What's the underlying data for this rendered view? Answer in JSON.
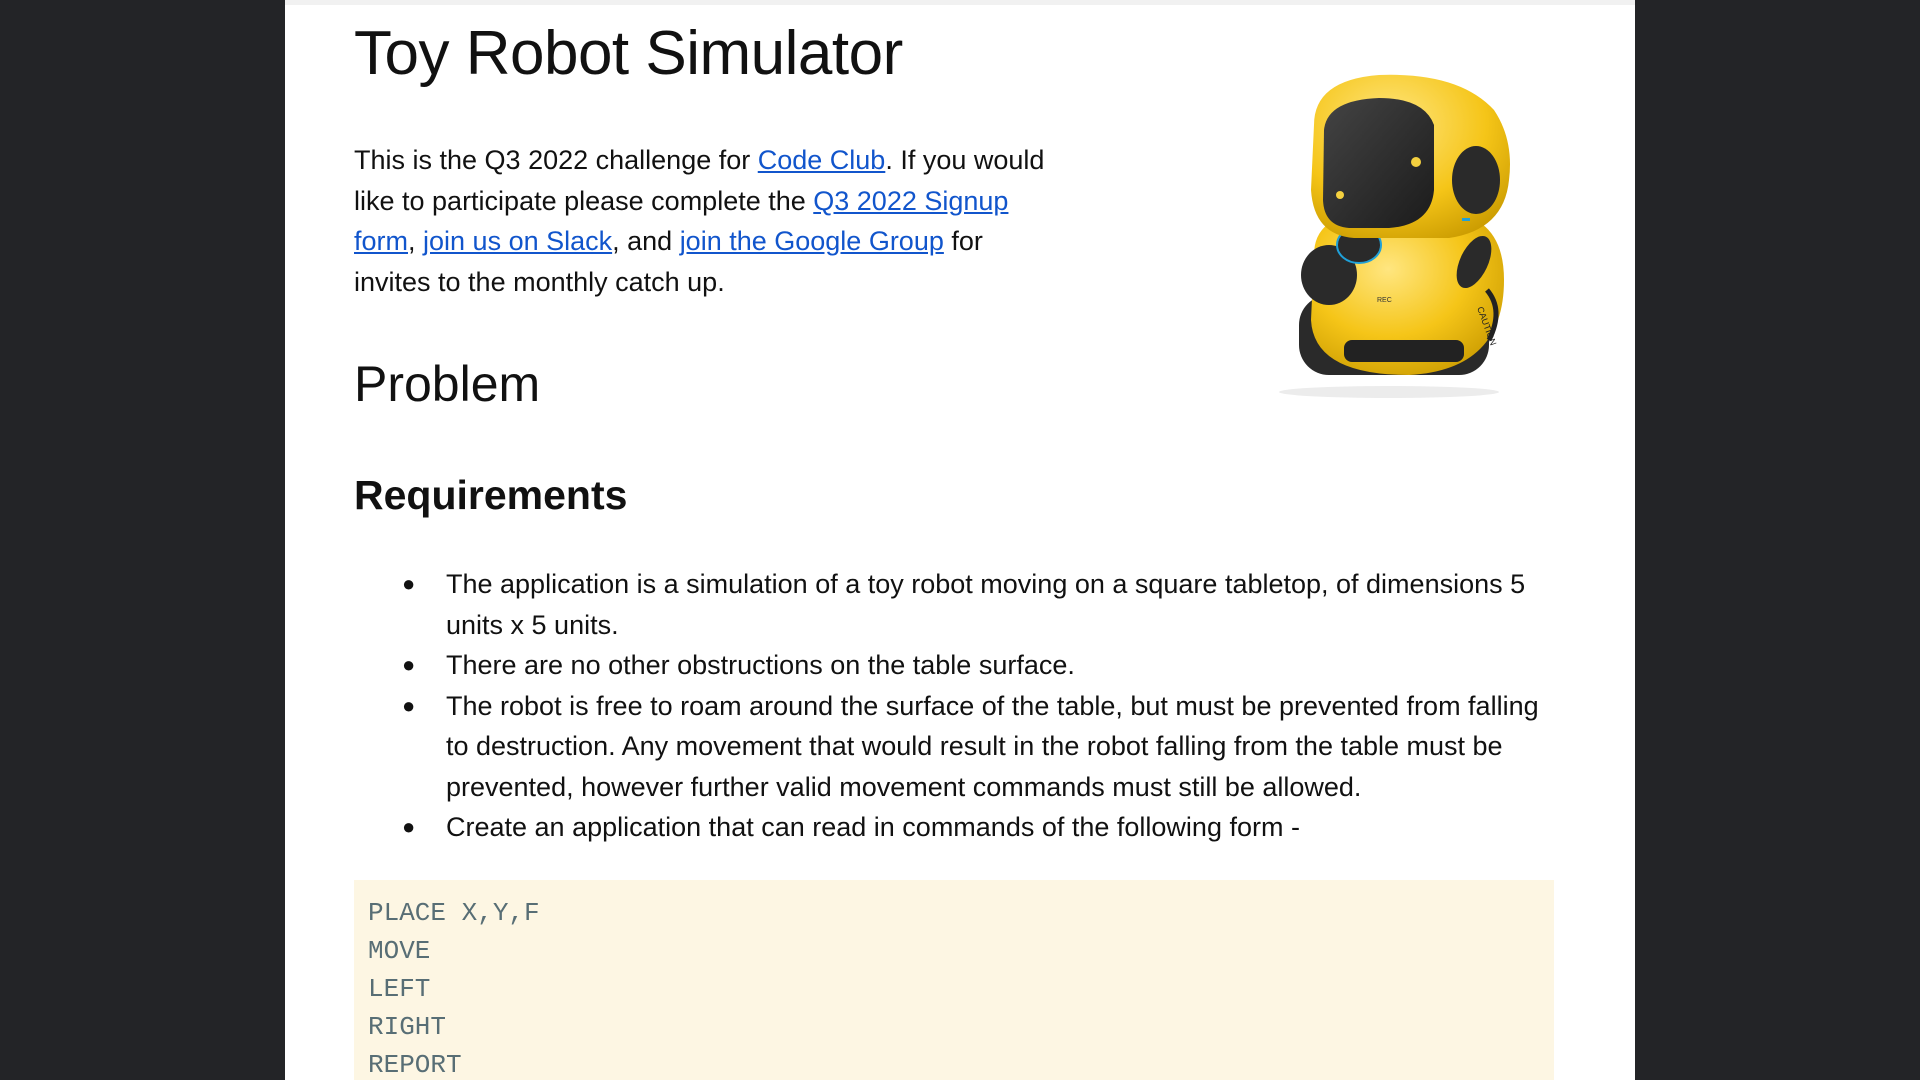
{
  "doc": {
    "title": "Toy Robot Simulator",
    "intro": {
      "t1": "This is the Q3 2022 challenge for ",
      "link_codeclub": "Code Club",
      "t2": ". If you would like to participate please complete the ",
      "link_signup": "Q3 2022 Signup form",
      "t3": ", ",
      "link_slack": "join us on Slack",
      "t4": ", and ",
      "link_google": "join the Google Group",
      "t5": " for invites to the monthly catch up."
    },
    "h_problem": "Problem",
    "h_requirements": "Requirements",
    "bullet_char": "●",
    "requirements": [
      "The application is a simulation of a toy robot moving on a square tabletop, of dimensions 5 units x 5 units.",
      "There are no other obstructions on the table surface.",
      "The robot is free to roam around the surface of the table, but must be prevented from falling to destruction. Any movement that would result in the robot falling from the table must be prevented, however further valid movement commands must still be allowed.",
      "Create an application that can read in commands of the following form -"
    ],
    "code_lines": [
      "PLACE X,Y,F",
      "MOVE",
      "LEFT",
      "RIGHT",
      "REPORT"
    ]
  },
  "robot_image": {
    "labels": [
      "REC",
      "CAUTION"
    ],
    "colors": {
      "body": "#f5c518",
      "face": "#2b2b2b",
      "eyes": "#f4d03f",
      "accent": "#1fa0d8"
    }
  }
}
